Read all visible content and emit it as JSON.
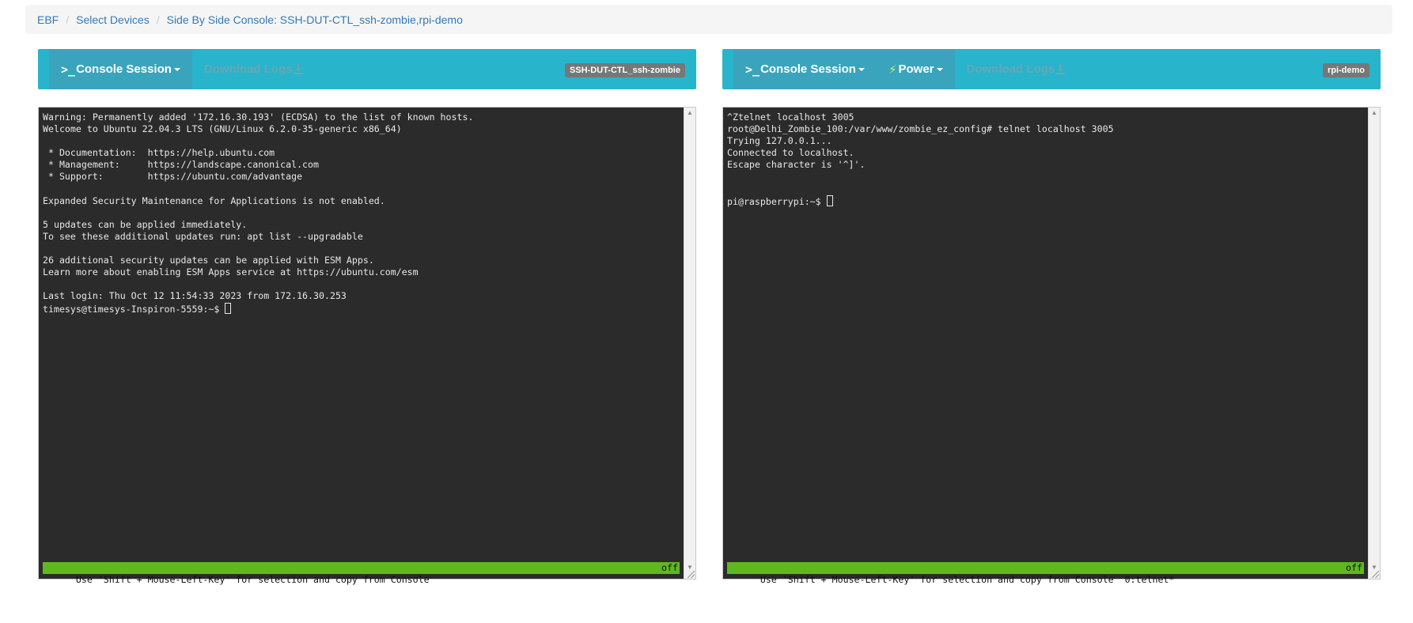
{
  "breadcrumb": [
    "EBF",
    "Select Devices",
    "Side By Side Console: SSH-DUT-CTL_ssh-zombie,rpi-demo"
  ],
  "colors": {
    "navbar": "#28b4cb",
    "terminal_bg": "#2b2b2b",
    "status_bar": "#5fb81f",
    "link": "#337ab7"
  },
  "left_panel": {
    "console_session_label": "Console Session",
    "download_logs_label": "Download Logs",
    "device_badge": "SSH-DUT-CTL_ssh-zombie",
    "terminal_text": "Warning: Permanently added '172.16.30.193' (ECDSA) to the list of known hosts.\nWelcome to Ubuntu 22.04.3 LTS (GNU/Linux 6.2.0-35-generic x86_64)\n\n * Documentation:  https://help.ubuntu.com\n * Management:     https://landscape.canonical.com\n * Support:        https://ubuntu.com/advantage\n\nExpanded Security Maintenance for Applications is not enabled.\n\n5 updates can be applied immediately.\nTo see these additional updates run: apt list --upgradable\n\n26 additional security updates can be applied with ESM Apps.\nLearn more about enabling ESM Apps service at https://ubuntu.com/esm\n\nLast login: Thu Oct 12 11:54:33 2023 from 172.16.30.253\ntimesys@timesys-Inspiron-5559:~$ ",
    "status_text": "Use 'Shift + Mouse-Left-Key' for selection and copy from Console",
    "status_right": "off"
  },
  "right_panel": {
    "console_session_label": "Console Session",
    "power_label": "Power",
    "download_logs_label": "Download Logs",
    "device_badge": "rpi-demo",
    "terminal_text": "^Ztelnet localhost 3005\nroot@Delhi_Zombie_100:/var/www/zombie_ez_config# telnet localhost 3005\nTrying 127.0.0.1...\nConnected to localhost.\nEscape character is '^]'.\n\n\npi@raspberrypi:~$ ",
    "status_text": "Use 'Shift + Mouse-Left-Key' for selection and copy from Console  0:telnet*",
    "status_right": "off"
  },
  "icons": {
    "console": "terminal-prompt-icon",
    "power": "bolt-icon",
    "download": "download-icon",
    "caret": "caret-down-icon"
  }
}
